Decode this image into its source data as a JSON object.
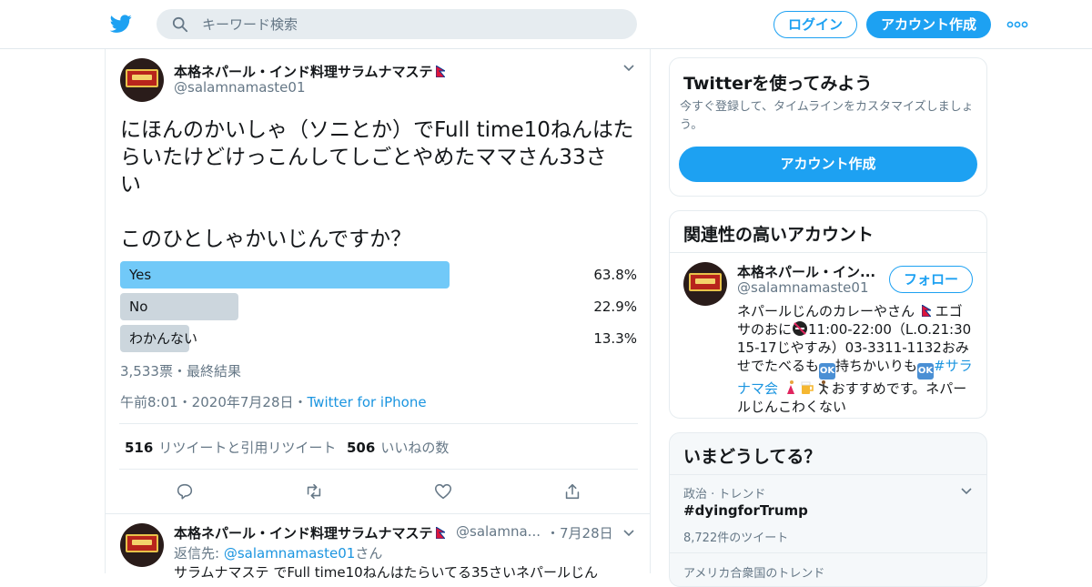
{
  "header": {
    "logo": "twitter-bird-icon",
    "search_placeholder": "キーワード検索",
    "login_label": "ログイン",
    "signup_label": "アカウント作成",
    "more_icon": "more-dots-icon",
    "brand_color": "#1da1f2"
  },
  "tweet": {
    "name": "本格ネパール・インド料理サラムナマステ",
    "handle": "@salamnamaste01",
    "text_lines": [
      "にほんのかいしゃ（ソニとか）でFull time10ねんはた",
      "らいたけどけっこんしてしごとやめたママさん33さ",
      "い",
      "このひとしゃかいじんですか？"
    ],
    "poll": {
      "options": [
        {
          "label": "Yes",
          "percent": "63.8%",
          "fraction": 0.638,
          "color": "#71c9f8"
        },
        {
          "label": "No",
          "percent": "22.9%",
          "fraction": 0.229,
          "color": "#ccd6dd"
        },
        {
          "label": "わかんない",
          "percent": "13.3%",
          "fraction": 0.133,
          "color": "#ccd6dd"
        }
      ],
      "summary": "3,533票・最終結果"
    },
    "time": "午前8:01・2020年7月28日・",
    "source": "Twitter for iPhone",
    "retweets_count": "516",
    "retweets_label": "リツイートと引用リツイート",
    "likes_count": "506",
    "likes_label": "いいねの数"
  },
  "reply_tweet": {
    "name": "本格ネパール・インド料理サラムナマステ",
    "handle": "@salamna...",
    "date": "・7月28日",
    "reply_prefix": "返信先: ",
    "reply_to": "@salamnamaste01",
    "reply_suffix": "さん",
    "text": "サラムナマステ でFull time10ねんはたらいてる35さいネパールじん"
  },
  "signup_card": {
    "title": "Twitterを使ってみよう",
    "subtitle": "今すぐ登録して、タイムラインをカスタマイズしましょう。",
    "button_label": "アカウント作成"
  },
  "related_card": {
    "title": "関連性の高いアカウント",
    "name": "本格ネパール・イン...",
    "handle": "@salamnamaste01",
    "follow_label": "フォロー",
    "bio": {
      "part1": "ネパールじんのカレーやさん",
      "part2": "エゴサのおに",
      "part3": "11:00-22:00（L.O.21:30 15-17じやすみ）03-3311-1132おみせでたべるも",
      "part4": "持ちかいりも",
      "hashtag": "#サラナマ会",
      "part5": "おすすめです。ネパールじんこわくない",
      "ok": "OK"
    }
  },
  "trends_card": {
    "title": "いまどうしてる？",
    "items": [
      {
        "meta": "政治 · トレンド",
        "name": "#dyingforTrump",
        "count": "8,722件のツイート"
      },
      {
        "meta": "アメリカ合衆国のトレンド"
      }
    ]
  }
}
